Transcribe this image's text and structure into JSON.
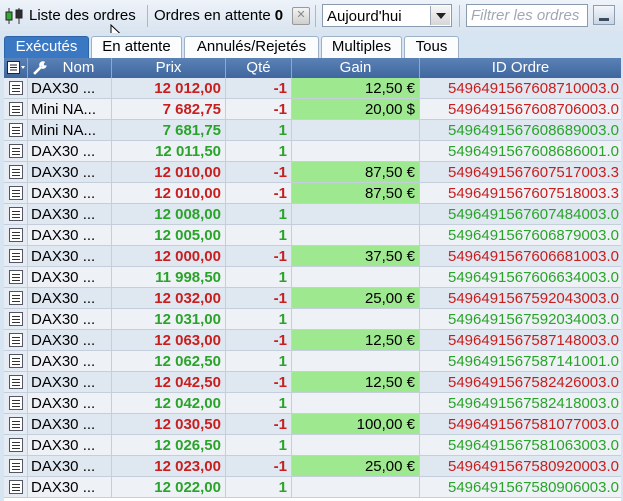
{
  "toolbar": {
    "title": "Liste des ordres",
    "pending_label": "Ordres en attente",
    "pending_count": "0",
    "period_value": "Aujourd'hui",
    "filter_placeholder": "Filtrer les ordres"
  },
  "tabs": [
    {
      "label": "Exécutés",
      "active": true
    },
    {
      "label": "En attente",
      "active": false
    },
    {
      "label": "Annulés/Rejetés",
      "active": false
    },
    {
      "label": "Multiples",
      "active": false
    },
    {
      "label": "Tous",
      "active": false
    }
  ],
  "columns": {
    "name": "Nom",
    "price": "Prix",
    "qty": "Qté",
    "gain": "Gain",
    "id": "ID Ordre"
  },
  "colors": {
    "buy": "#2aa32a",
    "sell": "#c81e1e",
    "gain_bg": "#9ee88f",
    "header": "#4a72a8"
  },
  "rows": [
    {
      "name": "DAX30 ...",
      "price": "12 012,00",
      "qty": "-1",
      "gain": "12,50 €",
      "id": "5496491567608710003.0",
      "side": "sell"
    },
    {
      "name": "Mini NA...",
      "price": "7 682,75",
      "qty": "-1",
      "gain": "20,00 $",
      "id": "5496491567608706003.0",
      "side": "sell"
    },
    {
      "name": "Mini NA...",
      "price": "7 681,75",
      "qty": "1",
      "gain": "",
      "id": "5496491567608689003.0",
      "side": "buy"
    },
    {
      "name": "DAX30 ...",
      "price": "12 011,50",
      "qty": "1",
      "gain": "",
      "id": "5496491567608686001.0",
      "side": "buy"
    },
    {
      "name": "DAX30 ...",
      "price": "12 010,00",
      "qty": "-1",
      "gain": "87,50 €",
      "id": "5496491567607517003.3",
      "side": "sell"
    },
    {
      "name": "DAX30 ...",
      "price": "12 010,00",
      "qty": "-1",
      "gain": "87,50 €",
      "id": "5496491567607518003.3",
      "side": "sell"
    },
    {
      "name": "DAX30 ...",
      "price": "12 008,00",
      "qty": "1",
      "gain": "",
      "id": "5496491567607484003.0",
      "side": "buy"
    },
    {
      "name": "DAX30 ...",
      "price": "12 005,00",
      "qty": "1",
      "gain": "",
      "id": "5496491567606879003.0",
      "side": "buy"
    },
    {
      "name": "DAX30 ...",
      "price": "12 000,00",
      "qty": "-1",
      "gain": "37,50 €",
      "id": "5496491567606681003.0",
      "side": "sell"
    },
    {
      "name": "DAX30 ...",
      "price": "11 998,50",
      "qty": "1",
      "gain": "",
      "id": "5496491567606634003.0",
      "side": "buy"
    },
    {
      "name": "DAX30 ...",
      "price": "12 032,00",
      "qty": "-1",
      "gain": "25,00 €",
      "id": "5496491567592043003.0",
      "side": "sell"
    },
    {
      "name": "DAX30 ...",
      "price": "12 031,00",
      "qty": "1",
      "gain": "",
      "id": "5496491567592034003.0",
      "side": "buy"
    },
    {
      "name": "DAX30 ...",
      "price": "12 063,00",
      "qty": "-1",
      "gain": "12,50 €",
      "id": "5496491567587148003.0",
      "side": "sell"
    },
    {
      "name": "DAX30 ...",
      "price": "12 062,50",
      "qty": "1",
      "gain": "",
      "id": "5496491567587141001.0",
      "side": "buy"
    },
    {
      "name": "DAX30 ...",
      "price": "12 042,50",
      "qty": "-1",
      "gain": "12,50 €",
      "id": "5496491567582426003.0",
      "side": "sell"
    },
    {
      "name": "DAX30 ...",
      "price": "12 042,00",
      "qty": "1",
      "gain": "",
      "id": "5496491567582418003.0",
      "side": "buy"
    },
    {
      "name": "DAX30 ...",
      "price": "12 030,50",
      "qty": "-1",
      "gain": "100,00 €",
      "id": "5496491567581077003.0",
      "side": "sell"
    },
    {
      "name": "DAX30 ...",
      "price": "12 026,50",
      "qty": "1",
      "gain": "",
      "id": "5496491567581063003.0",
      "side": "buy"
    },
    {
      "name": "DAX30 ...",
      "price": "12 023,00",
      "qty": "-1",
      "gain": "25,00 €",
      "id": "5496491567580920003.0",
      "side": "sell"
    },
    {
      "name": "DAX30 ...",
      "price": "12 022,00",
      "qty": "1",
      "gain": "",
      "id": "5496491567580906003.0",
      "side": "buy"
    }
  ]
}
